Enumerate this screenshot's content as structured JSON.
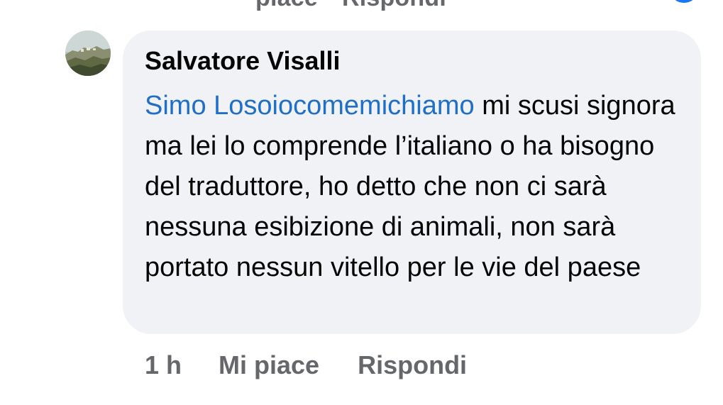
{
  "previous_comment": {
    "action_like": "piace",
    "action_reply": "Rispondi"
  },
  "comment": {
    "author": "Salvatore Visalli",
    "mention": "Simo Losoiocomemichiamo",
    "text": " mi scusi signora ma lei lo comprende l’italiano o ha bisogno del traduttore, ho detto che non ci sarà nessuna esibizione di animali, non sarà portato nessun vitello per le vie del paese",
    "time": "1 h",
    "like_label": "Mi piace",
    "reply_label": "Rispondi"
  },
  "colors": {
    "bubble": "#f0f2f5",
    "mention": "#1f6fc7",
    "secondary_text": "#65676b",
    "primary_text": "#050505"
  },
  "icons": {
    "avatar": "landscape-avatar",
    "reaction": "reaction-icon"
  }
}
